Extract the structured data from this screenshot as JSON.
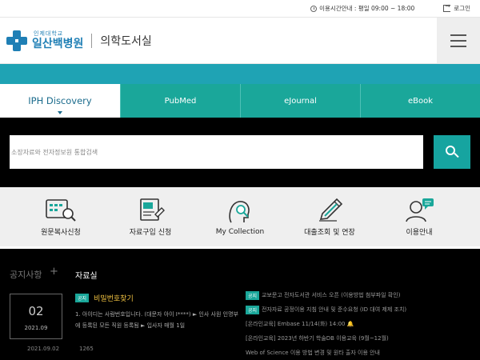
{
  "util": {
    "hours_text": "이용시간안내 : 평일 09:00 ~ 18:00",
    "login_label": "로그인"
  },
  "header": {
    "logo_small": "인제대학교",
    "logo_main": "일산백병원",
    "logo_sub": "의학도서실"
  },
  "tabs": [
    {
      "label": "IPH Discovery"
    },
    {
      "label": "PubMed"
    },
    {
      "label": "eJournal"
    },
    {
      "label": "eBook"
    }
  ],
  "search": {
    "placeholder": "소장자료와 전자정보원 통합검색"
  },
  "quick": [
    {
      "label": "원문복사신청"
    },
    {
      "label": "자료구입 신청"
    },
    {
      "label": "My Collection"
    },
    {
      "label": "대출조회 및 연장"
    },
    {
      "label": "이용안내"
    }
  ],
  "notice": {
    "title": "공지사항",
    "plus": "+",
    "data_title": "자료실",
    "card_day": "02",
    "card_ym": "2021.09",
    "post_tag": "공지",
    "post_title": "비밀번호찾기",
    "post_body": "1. 아이디는 사람번호입니다. (대문자 아이 I****)    ► 인사 사원 인명부에 등록된 모든 직원 등록됨     ► 입사자 매월 1일",
    "post_date": "2021.09.02",
    "post_views": "1265",
    "list": [
      {
        "tag": "공지",
        "text": "교보문고 전자도서관 서비스 오픈 (이용방법 첨부파일 확인)"
      },
      {
        "tag": "공지",
        "text": "전자자료 공정이용 지침 안내 및 준수요청 (ID 대여 제제 조치)"
      },
      {
        "tag": "",
        "text": "[온라인교육] Embase 11/14(화) 14:00 🔔"
      },
      {
        "tag": "",
        "text": "[온라인교육] 2023년 하반기 학술DB 이용교육 (9월~12월)"
      },
      {
        "tag": "",
        "text": "Web of Science 이용 방법 변경 및 원타 출자 이용 안내"
      }
    ]
  }
}
